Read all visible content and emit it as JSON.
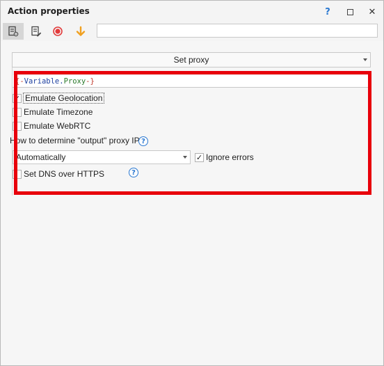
{
  "window": {
    "title": "Action properties",
    "help_glyph": "?",
    "close_glyph": "✕"
  },
  "toolbar": {
    "items": [
      {
        "icon": "properties-settings-icon",
        "active": true
      },
      {
        "icon": "edit-document-icon",
        "active": false
      },
      {
        "icon": "record-icon",
        "active": false
      },
      {
        "icon": "arrow-down-icon",
        "active": false
      }
    ],
    "search_value": ""
  },
  "action": {
    "selected": "Set proxy"
  },
  "proxy": {
    "open": "{-",
    "var": "Variable.",
    "name": "Proxy",
    "close": "-}"
  },
  "options": {
    "emulate_geolocation": {
      "label": "Emulate Geolocation",
      "checked": true
    },
    "emulate_timezone": {
      "label": "Emulate Timezone",
      "checked": false
    },
    "emulate_webrtc": {
      "label": "Emulate WebRTC",
      "checked": false
    },
    "set_dns_over_https": {
      "label": "Set DNS over HTTPS",
      "checked": false
    }
  },
  "output_ip": {
    "label": "How to determine \"output\" proxy IP:",
    "mode": "Automatically",
    "ignore_errors": {
      "label": "Ignore errors",
      "checked": true
    }
  },
  "colors": {
    "highlight": "#e8000b",
    "accent": "#2a78d1",
    "record": "#e23b3b",
    "arrow": "#f0a020"
  },
  "check_glyph": "✓",
  "help_glyph": "?"
}
